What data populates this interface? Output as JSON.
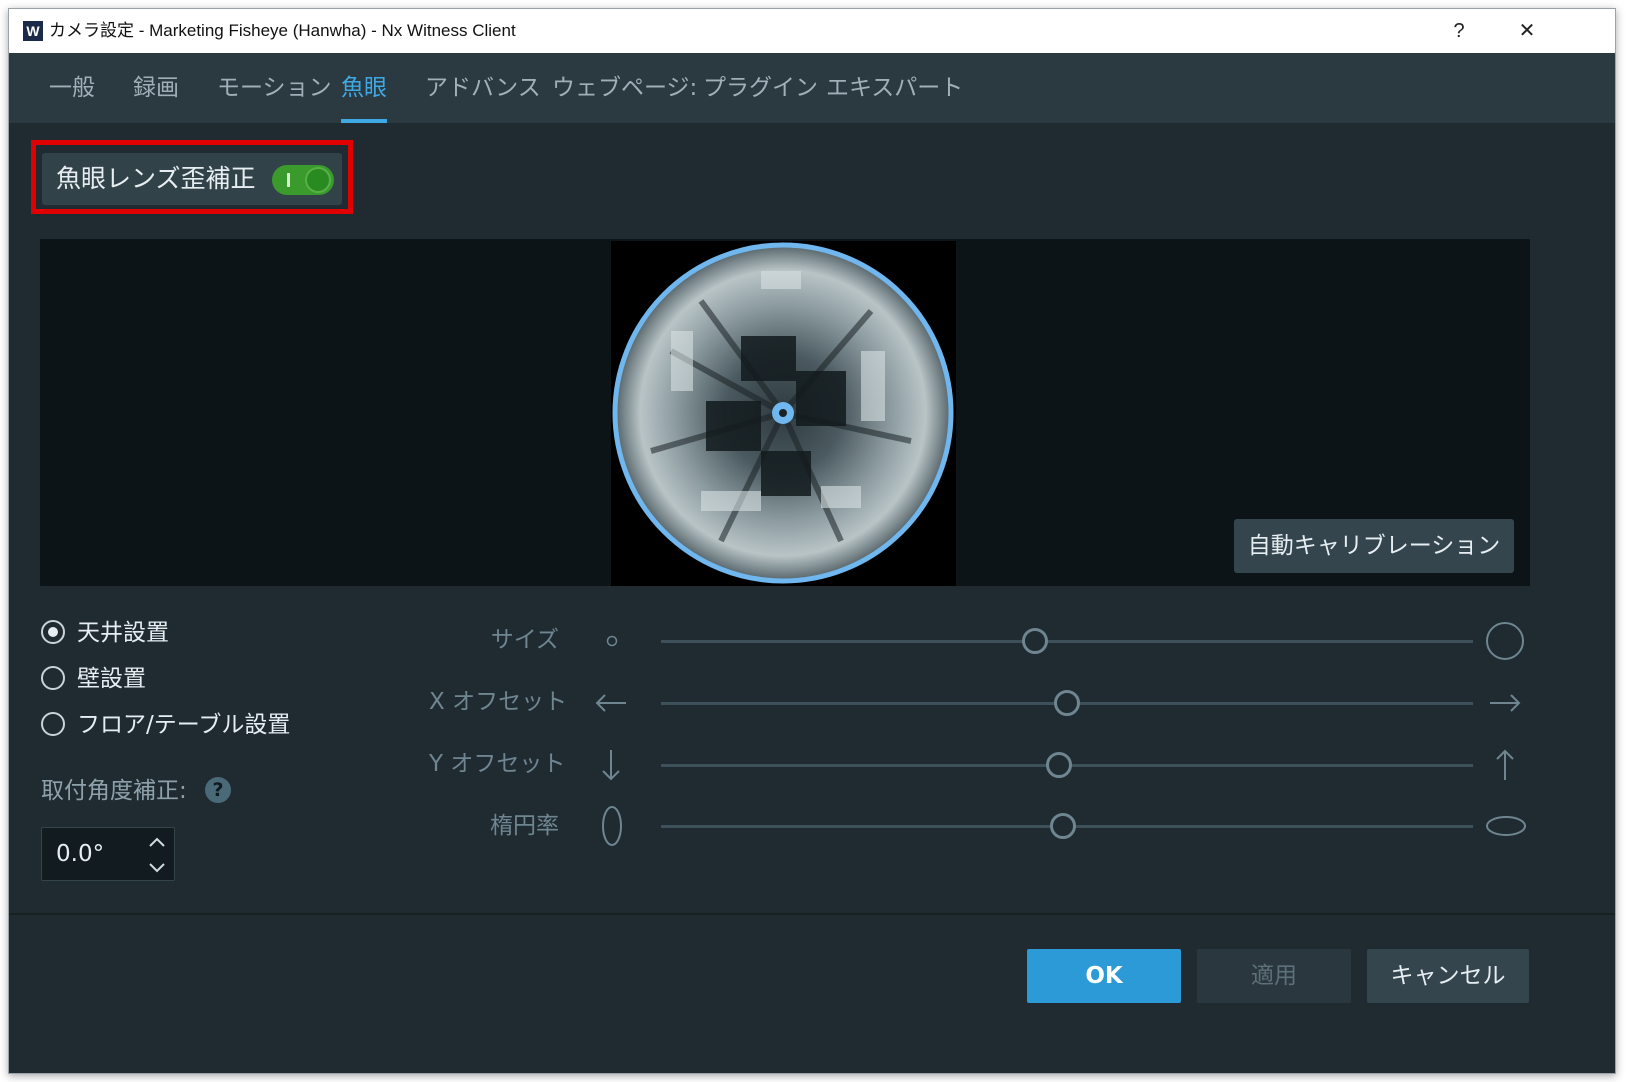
{
  "window": {
    "title": "カメラ設定 - Marketing Fisheye (Hanwha) - Nx Witness Client",
    "app_logo": "W",
    "help_btn": "?",
    "close_btn": "✕"
  },
  "tabs": [
    {
      "label": "一般"
    },
    {
      "label": "録画"
    },
    {
      "label": "モーション"
    },
    {
      "label": "魚眼",
      "active": true
    },
    {
      "label": "アドバンス"
    },
    {
      "label": "ウェブページ:"
    },
    {
      "label": "プラグイン"
    },
    {
      "label": "エキスパート"
    }
  ],
  "dewarp": {
    "label": "魚眼レンズ歪補正",
    "enabled": true
  },
  "calibration_button": "自動キャリブレーション",
  "mount": {
    "options": [
      "天井設置",
      "壁設置",
      "フロア/テーブル設置"
    ],
    "selected_index": 0
  },
  "angle": {
    "label": "取付角度補正:",
    "help": "?",
    "value": "0.0°"
  },
  "sliders": [
    {
      "label": "サイズ",
      "value": 0.46,
      "left_icon": "small-circle-icon",
      "right_icon": "large-circle-icon"
    },
    {
      "label": "X オフセット",
      "value": 0.5,
      "left_icon": "arrow-left-icon",
      "right_icon": "arrow-right-icon"
    },
    {
      "label": "Y オフセット",
      "value": 0.49,
      "left_icon": "arrow-down-icon",
      "right_icon": "arrow-up-icon"
    },
    {
      "label": "楕円率",
      "value": 0.495,
      "left_icon": "vertical-ellipse-icon",
      "right_icon": "horizontal-ellipse-icon"
    }
  ],
  "buttons": {
    "ok": "OK",
    "apply": "適用",
    "cancel": "キャンセル"
  },
  "colors": {
    "accent": "#3fa9e6",
    "toggle_on": "#3a9a2c",
    "highlight_box": "#e10000",
    "ok_button": "#2d9ad8"
  }
}
